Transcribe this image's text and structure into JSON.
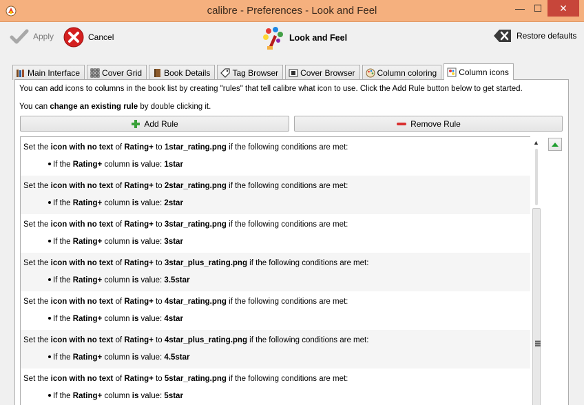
{
  "window": {
    "title": "calibre - Preferences - Look and Feel",
    "minimize_glyph": "—",
    "maximize_glyph": "☐",
    "close_glyph": "✕"
  },
  "toolbar": {
    "apply_label": "Apply",
    "cancel_label": "Cancel",
    "section_title": "Look and Feel",
    "restore_label": "Restore defaults"
  },
  "tabs": [
    {
      "label": "Main Interface",
      "icon": "books-icon"
    },
    {
      "label": "Cover Grid",
      "icon": "grid-icon"
    },
    {
      "label": "Book Details",
      "icon": "book-icon"
    },
    {
      "label": "Tag Browser",
      "icon": "tag-icon"
    },
    {
      "label": "Cover Browser",
      "icon": "cover-browser-icon"
    },
    {
      "label": "Column coloring",
      "icon": "palette-icon"
    },
    {
      "label": "Column icons",
      "icon": "column-icons-icon",
      "active": true
    }
  ],
  "help": {
    "line1": "You can add icons to columns in the book list by creating \"rules\" that tell calibre what icon to use. Click the Add Rule button below to get started.",
    "line2_prefix": "You can ",
    "line2_bold": "change an existing rule",
    "line2_suffix": " by double clicking it."
  },
  "buttons": {
    "add_rule": "Add Rule",
    "remove_rule": "Remove Rule"
  },
  "rule_text": {
    "set_the": "Set the ",
    "icon_kind": "icon with no text",
    "of": " of ",
    "to": " to ",
    "conditions": " if the following conditions are met:",
    "if_the": "If the ",
    "column_is": " column ",
    "is": "is",
    "value": " value: "
  },
  "rules": [
    {
      "column": "Rating+",
      "file": "1star_rating.png",
      "value": "1star"
    },
    {
      "column": "Rating+",
      "file": "2star_rating.png",
      "value": "2star"
    },
    {
      "column": "Rating+",
      "file": "3star_rating.png",
      "value": "3star"
    },
    {
      "column": "Rating+",
      "file": "3star_plus_rating.png",
      "value": "3.5star"
    },
    {
      "column": "Rating+",
      "file": "4star_rating.png",
      "value": "4star"
    },
    {
      "column": "Rating+",
      "file": "4star_plus_rating.png",
      "value": "4.5star"
    },
    {
      "column": "Rating+",
      "file": "5star_rating.png",
      "value": "5star"
    }
  ],
  "colors": {
    "titlebar": "#f5b07e",
    "close": "#c7463a",
    "add_green": "#3aa13a",
    "remove_red": "#d93030",
    "cancel_red": "#d42020"
  }
}
